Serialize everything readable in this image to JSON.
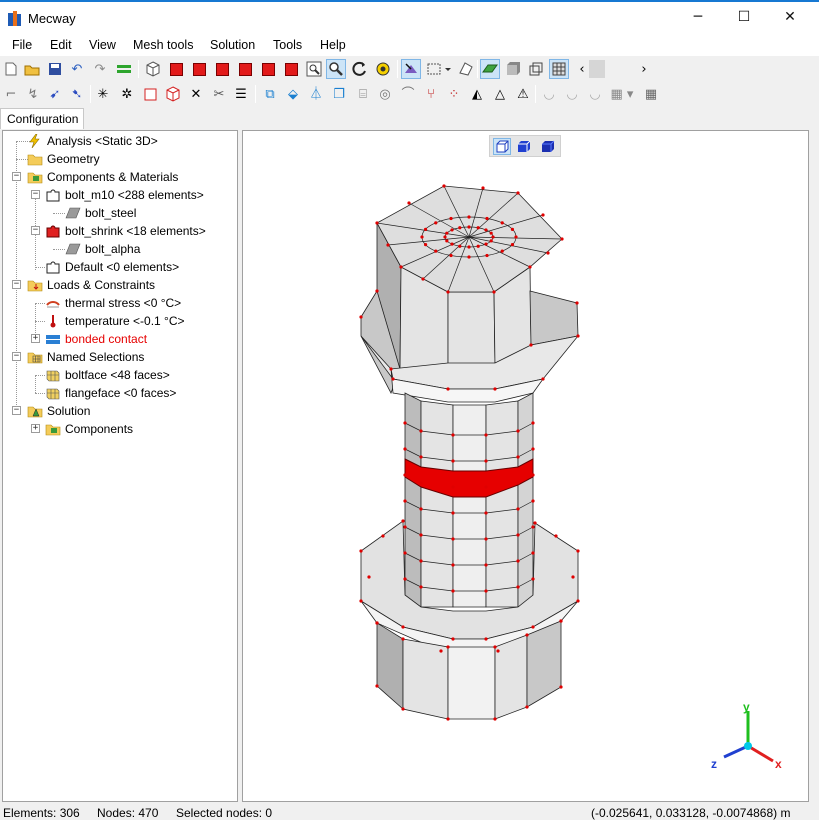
{
  "window": {
    "title": "Mecway",
    "minimize_glyph": "─",
    "maximize_glyph": "☐",
    "close_glyph": "✕"
  },
  "menu": [
    "File",
    "Edit",
    "View",
    "Mesh tools",
    "Solution",
    "Tools",
    "Help"
  ],
  "tabs": {
    "active": "Configuration"
  },
  "tree": {
    "analysis": "Analysis <Static 3D>",
    "geometry": "Geometry",
    "components_materials": "Components & Materials",
    "bolt_m10": "bolt_m10 <288 elements>",
    "bolt_steel": "bolt_steel",
    "bolt_shrink": "bolt_shrink <18 elements>",
    "bolt_alpha": "bolt_alpha",
    "default": "Default <0 elements>",
    "loads_constraints": "Loads & Constraints",
    "thermal_stress": "thermal stress <0 °C>",
    "temperature": "temperature <-0.1 °C>",
    "bonded_contact": "bonded contact",
    "named_selections": "Named Selections",
    "boltface": "boltface <48 faces>",
    "flangeface": "flangeface <0 faces>",
    "solution": "Solution",
    "solution_components": "Components"
  },
  "axes": {
    "x": "x",
    "y": "y",
    "z": "z"
  },
  "status": {
    "elements": "Elements: 306",
    "nodes": "Nodes: 470",
    "selected": "Selected nodes: 0",
    "coords": "(-0.025641, 0.033128, -0.0074868) m"
  },
  "colors": {
    "accent": "#1778d2",
    "highlight_red": "#e60000",
    "contact_blue": "#2a7fd4",
    "mesh_face": "#e4e4e4",
    "node_dot": "#e00000"
  },
  "icons": {
    "toolbar1": [
      "new-file-icon",
      "open-folder-icon",
      "save-icon",
      "undo-icon",
      "redo-icon",
      "equals-icon",
      "view-iso-icon",
      "view-front-icon",
      "view-back-icon",
      "view-left-icon",
      "view-right-icon",
      "view-top-icon",
      "view-bottom-icon",
      "zoom-box-icon",
      "zoom-icon",
      "rotate-icon",
      "pan-icon",
      "select-icon",
      "select-region-icon",
      "select-connected-icon",
      "surface-icon",
      "shaded-icon",
      "wireframe-icon",
      "mesh-icon"
    ],
    "toolbar2": [
      "select-nodes-icon",
      "select-elements-icon",
      "select-faces-icon",
      "select-edges-icon",
      "explode-icon",
      "explode-2-icon",
      "square-icon",
      "cube-outline-icon",
      "cross-icon",
      "cut-icon",
      "refine-icon",
      "extrude-icon",
      "revolve-icon",
      "mirror-icon",
      "copy-icon",
      "cylinder-icon",
      "torus-icon",
      "bend-icon",
      "y-split-icon",
      "scatter-icon",
      "fill-icon",
      "triangle-icon",
      "triangle-outline-icon",
      "arc-icon",
      "arc-2-icon",
      "arc-3-icon",
      "film-icon",
      "table-icon"
    ]
  }
}
